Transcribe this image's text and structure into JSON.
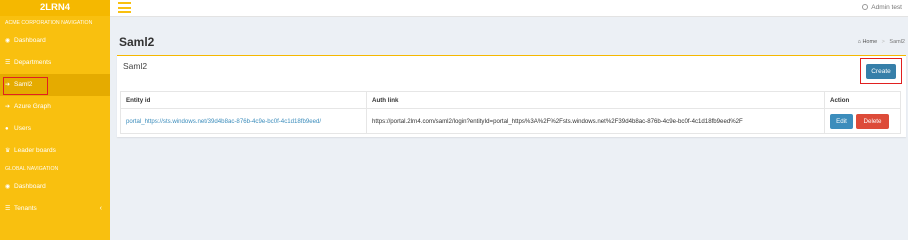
{
  "sidebar": {
    "brand": "2LRN4",
    "section1_header": "ACME CORPORATION NAVIGATION",
    "items": [
      {
        "label": "Dashboard",
        "icon": "dashboard-icon"
      },
      {
        "label": "Departments",
        "icon": "list-icon"
      },
      {
        "label": "Saml2",
        "icon": "sign-in-icon"
      },
      {
        "label": "Azure Graph",
        "icon": "sign-in-icon"
      },
      {
        "label": "Users",
        "icon": "user-icon"
      },
      {
        "label": "Leader boards",
        "icon": "trophy-icon"
      }
    ],
    "section2_header": "GLOBAL NAVIGATION",
    "global_items": [
      {
        "label": "Dashboard",
        "icon": "dashboard-icon"
      },
      {
        "label": "Tenants",
        "icon": "list-icon"
      }
    ]
  },
  "header": {
    "user_name": "Admin test"
  },
  "page": {
    "title": "Saml2",
    "breadcrumb": {
      "home": "Home",
      "current": "Saml2"
    }
  },
  "box": {
    "title": "Saml2",
    "create_label": "Create",
    "table": {
      "columns": [
        "Entity id",
        "Auth link",
        "Action"
      ],
      "rows": [
        {
          "entity_id": "portal_https://sts.windows.net/39d4b8ac-876b-4c9e-bc0f-4c1d18fb9eed/",
          "auth_link": "https://portal.2lrn4.com/saml2/login?entityId=portal_https%3A%2F%2Fsts.windows.net%2F39d4b8ac-876b-4c9e-bc0f-4c1d18fb9eed%2F",
          "edit_label": "Edit",
          "delete_label": "Delete"
        }
      ]
    }
  },
  "colors": {
    "sidebar": "#f9c00f",
    "primary": "#367fa9",
    "danger": "#dd4b39",
    "highlight": "#e12020"
  }
}
